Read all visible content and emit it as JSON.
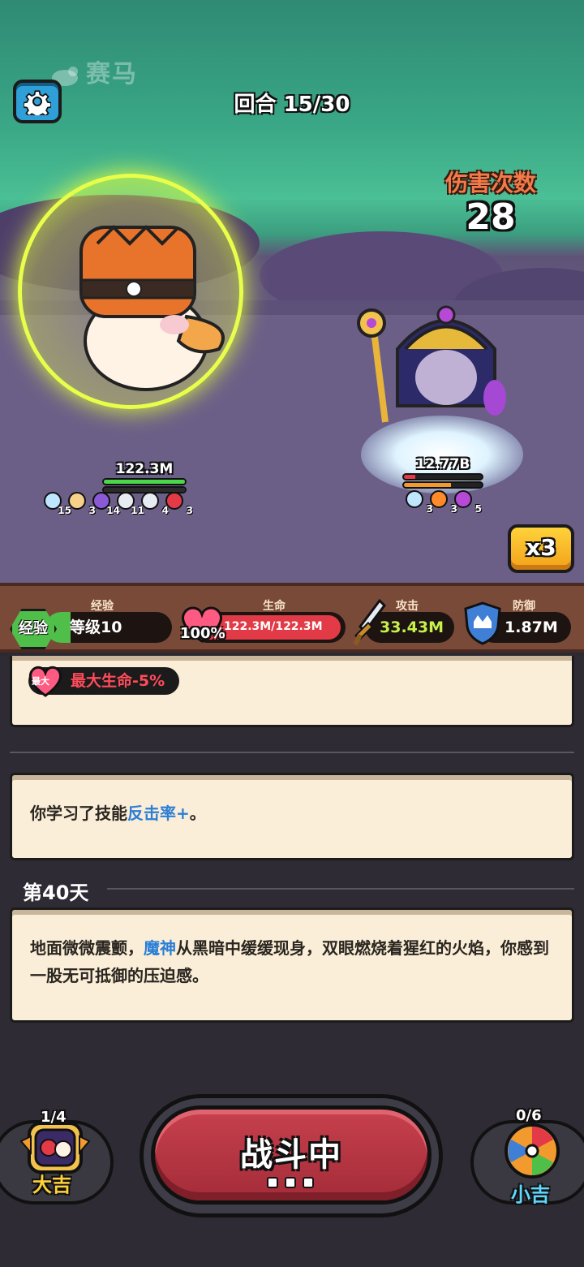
{
  "watermark": "赛马",
  "header": {
    "round_label": "回合 15/30",
    "hits_label": "伤害次数",
    "hits_value": "28"
  },
  "player_unit": {
    "hp": "122.3M",
    "hp_fraction": 1.0,
    "buffs": [
      {
        "icon": "ice-crystal-icon",
        "count": "15"
      },
      {
        "icon": "mouse-pet-icon",
        "count": "3"
      },
      {
        "icon": "shield-crest-icon",
        "count": "14"
      },
      {
        "icon": "sword-icon",
        "count": "11"
      },
      {
        "icon": "sword-icon",
        "count": "4"
      },
      {
        "icon": "fire-demon-icon",
        "count": "3"
      }
    ]
  },
  "enemy_unit": {
    "hp": "12.77B",
    "hp_fraction": 0.15,
    "debuffs": [
      {
        "icon": "ice-crystal-icon",
        "count": "3"
      },
      {
        "icon": "fire-icon",
        "count": "3"
      },
      {
        "icon": "skull-icon",
        "count": "5"
      }
    ]
  },
  "speed_button": "x3",
  "stats": {
    "xp_badge": "经验",
    "xp_label": "经验",
    "level_text": "等级10",
    "xp_fraction": 0.2,
    "hp_label": "生命",
    "hp_percent": "100%",
    "hp_text": "122.3M/122.3M",
    "atk_label": "攻击",
    "atk_value": "33.43M",
    "def_label": "防御",
    "def_value": "1.87M"
  },
  "log": {
    "card1": {
      "heart_tag": "最大",
      "text": "最大生命-5%"
    },
    "card2": {
      "prefix": "你学习了技能",
      "skill": "反击率+",
      "suffix": "。"
    },
    "day_title": "第40天",
    "card3": {
      "prefix": "地面微微震颤，",
      "name": "魔神",
      "suffix": "从黑暗中缓缓现身，双眼燃烧着猩红的火焰，你感到一股无可抵御的压迫感。"
    }
  },
  "bottom": {
    "left_count": "1/4",
    "left_name": "大吉",
    "fight_label": "战斗中",
    "right_count": "0/6",
    "right_name": "小吉"
  },
  "colors": {
    "accent_red": "#c7404d",
    "skill_blue": "#2b7fd6",
    "hit_orange": "#f27b4a",
    "left_name_color": "#ffd23a",
    "right_name_color": "#5fd8ff"
  }
}
